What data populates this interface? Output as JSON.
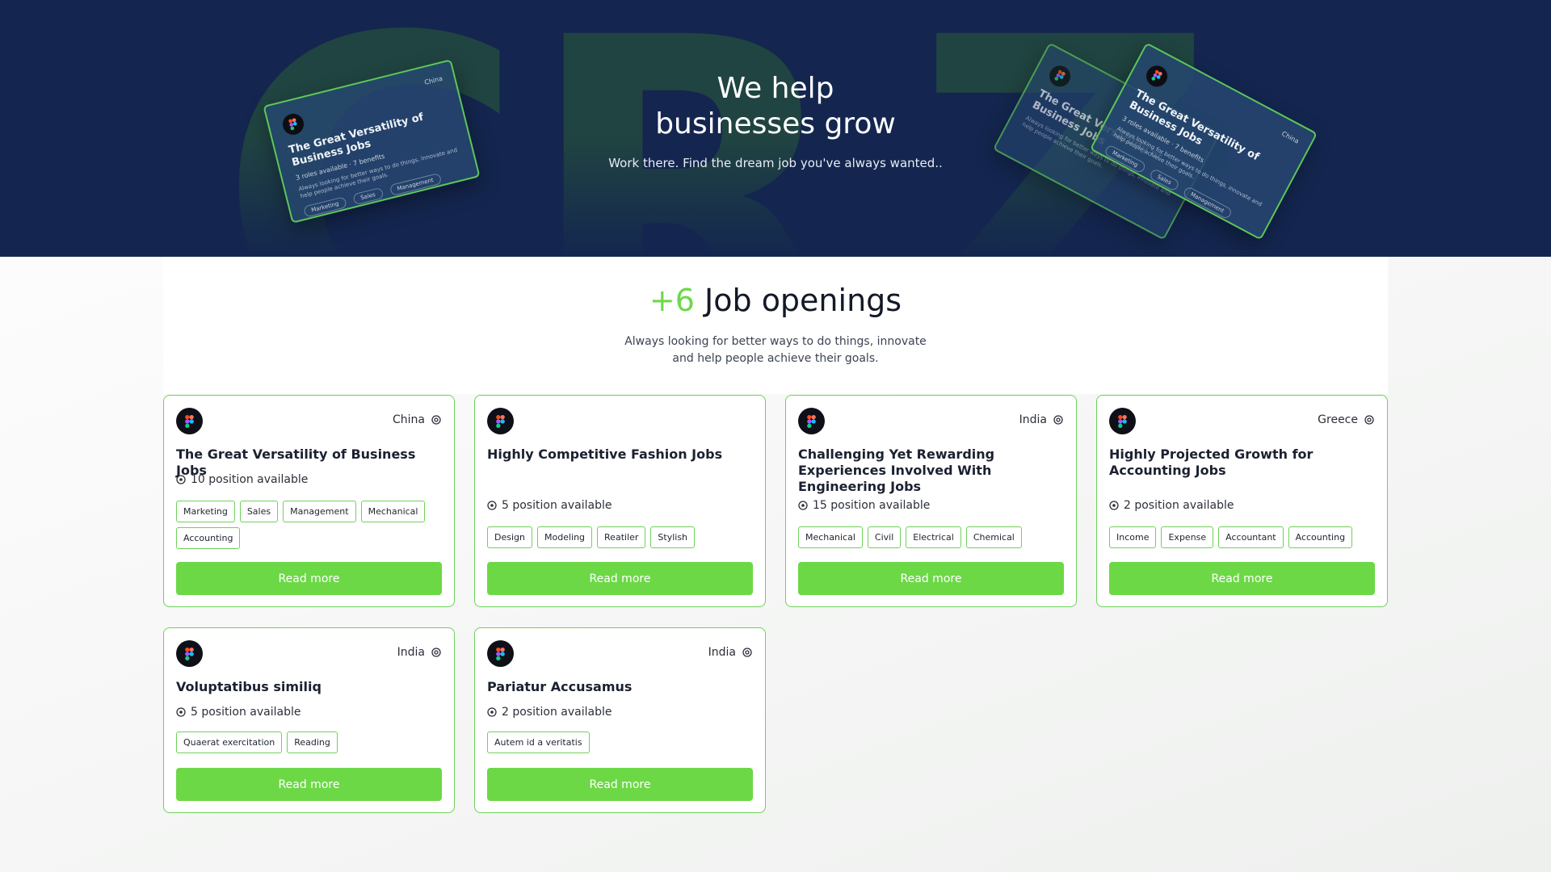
{
  "hero": {
    "title_line1": "We help",
    "title_line2": "businesses grow",
    "subtitle": "Work there. Find the dream job you've always wanted..",
    "bg_letters": [
      "C",
      "R",
      "Z"
    ],
    "preview_card": {
      "title": "The Great Versatility of Business Jobs",
      "location": "China",
      "roles": "3 roles available",
      "benefits": "7 benefits",
      "desc": "Always looking for better ways to do things, innovate and help people achieve their goals.",
      "tags": [
        "Marketing",
        "Sales",
        "Management"
      ]
    }
  },
  "openings": {
    "count": "+6",
    "title": "Job openings",
    "subtitle_line1": "Always looking for better ways to do things, innovate",
    "subtitle_line2": "and help people achieve their goals."
  },
  "colors": {
    "accent": "#6cd846",
    "hero_bg": "#14264f",
    "card_border": "#6fd15a"
  },
  "icons": {
    "logo": "figma-logo-icon",
    "location": "location-pin-icon",
    "positions": "target-icon"
  },
  "jobs": [
    {
      "title": "The Great Versatility of Business Jobs",
      "location": "China",
      "positions": "10 position available",
      "tags": [
        "Marketing",
        "Sales",
        "Management",
        "Mechanical",
        "Accounting"
      ],
      "button": "Read more"
    },
    {
      "title": "Highly Competitive Fashion Jobs",
      "location": "",
      "positions": "5 position available",
      "tags": [
        "Design",
        "Modeling",
        "Reatiler",
        "Stylish"
      ],
      "button": "Read more"
    },
    {
      "title": "Challenging Yet Rewarding Experiences Involved With Engineering Jobs",
      "location": "India",
      "positions": "15 position available",
      "tags": [
        "Mechanical",
        "Civil",
        "Electrical",
        "Chemical"
      ],
      "button": "Read more"
    },
    {
      "title": "Highly Projected Growth for Accounting Jobs",
      "location": "Greece",
      "positions": "2 position available",
      "tags": [
        "Income",
        "Expense",
        "Accountant",
        "Accounting"
      ],
      "button": "Read more"
    },
    {
      "title": "Voluptatibus similiq",
      "location": "India",
      "positions": "5 position available",
      "tags": [
        "Quaerat exercitation",
        "Reading"
      ],
      "button": "Read more"
    },
    {
      "title": "Pariatur Accusamus",
      "location": "India",
      "positions": "2 position available",
      "tags": [
        "Autem id a veritatis"
      ],
      "button": "Read more"
    }
  ]
}
